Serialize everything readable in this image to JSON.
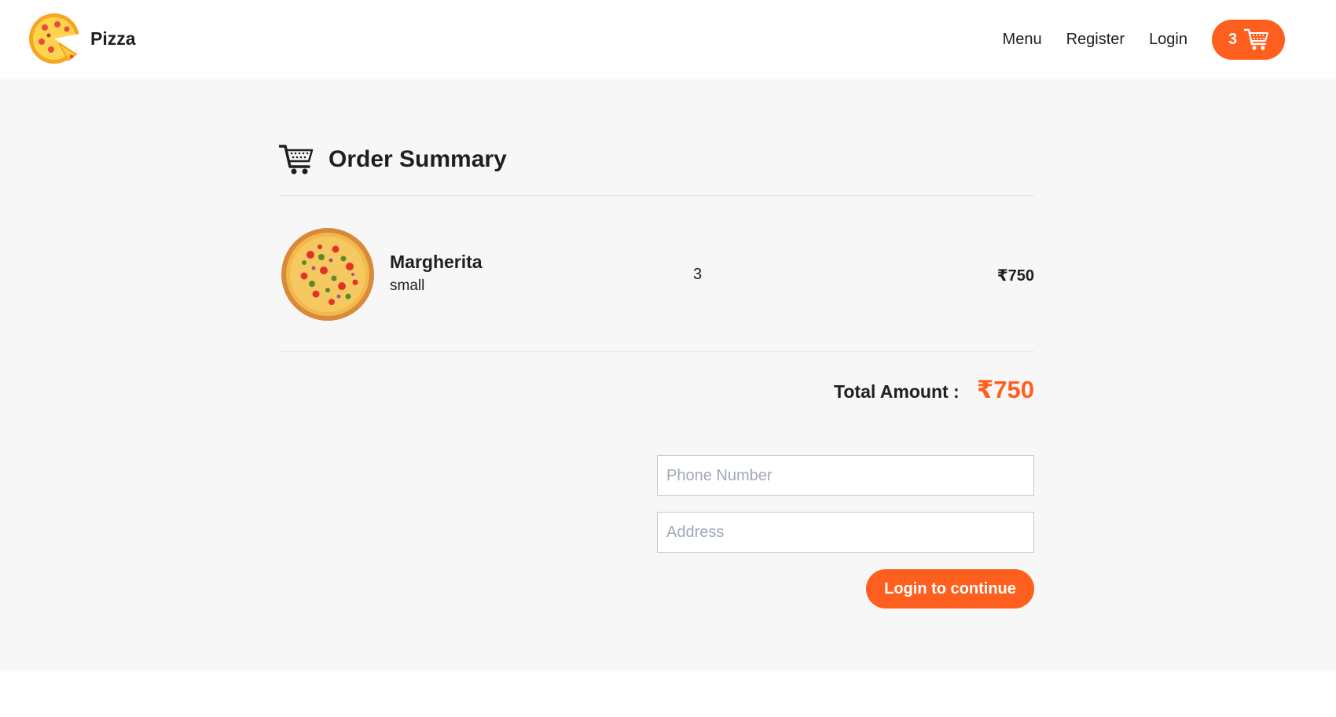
{
  "nav": {
    "logo_text": "Pizza",
    "links": [
      "Menu",
      "Register",
      "Login"
    ],
    "cart_count": "3"
  },
  "summary": {
    "heading": "Order Summary",
    "items": [
      {
        "name": "Margherita",
        "size": "small",
        "qty": "3",
        "price": "₹750"
      }
    ],
    "total_label": "Total Amount :",
    "total_value": "₹750"
  },
  "form": {
    "phone_placeholder": "Phone Number",
    "address_placeholder": "Address",
    "submit_label": "Login to continue"
  },
  "colors": {
    "accent": "#fe5f1e",
    "background": "#f7f7f7"
  }
}
